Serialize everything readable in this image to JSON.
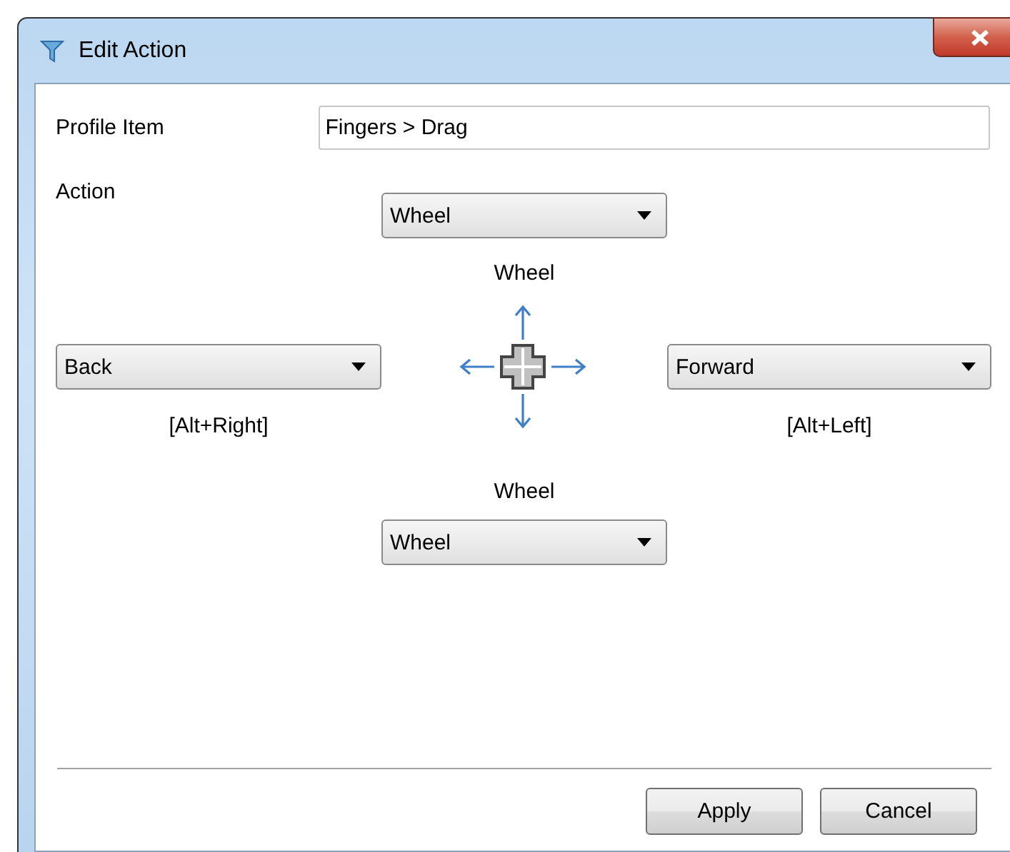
{
  "window": {
    "title": "Edit Action"
  },
  "profile_item": {
    "label": "Profile Item",
    "value": "Fingers > Drag"
  },
  "action": {
    "label": "Action",
    "directions": [
      {
        "kind": "up",
        "value": "Wheel",
        "caption": "Wheel"
      },
      {
        "kind": "left",
        "value": "Back",
        "caption": "[Alt+Right]"
      },
      {
        "kind": "right",
        "value": "Forward",
        "caption": "[Alt+Left]"
      },
      {
        "kind": "down",
        "value": "Wheel",
        "caption": "Wheel"
      }
    ]
  },
  "buttons": [
    "Apply",
    "Cancel"
  ]
}
